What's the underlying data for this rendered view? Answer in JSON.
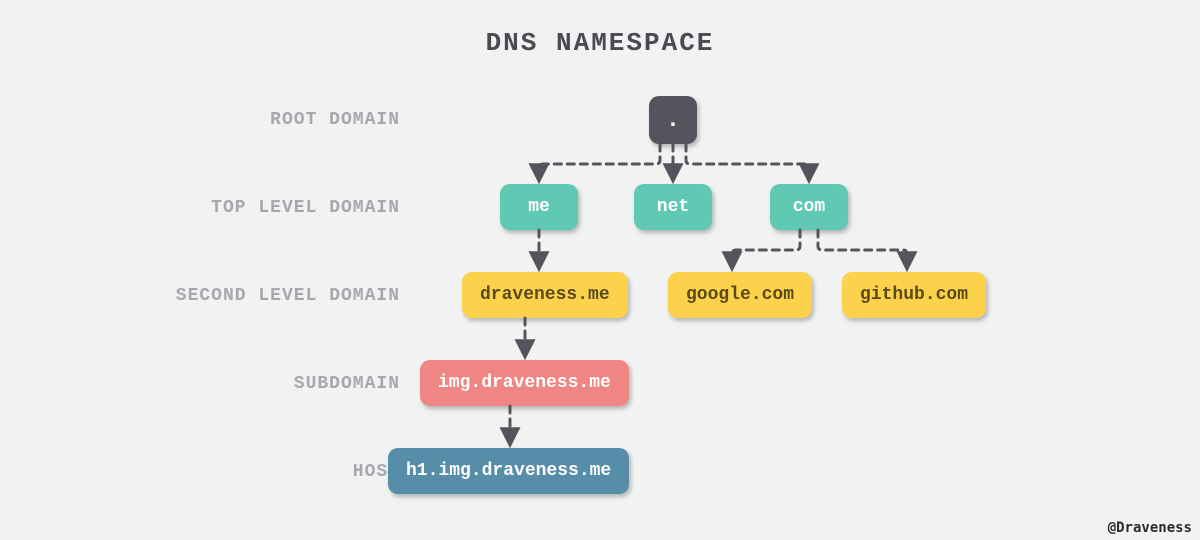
{
  "title": "DNS NAMESPACE",
  "levels": {
    "root": "ROOT DOMAIN",
    "tld": "TOP LEVEL DOMAIN",
    "sld": "SECOND LEVEL DOMAIN",
    "sub": "SUBDOMAIN",
    "host": "HOST"
  },
  "nodes": {
    "root": ".",
    "tld_me": "me",
    "tld_net": "net",
    "tld_com": "com",
    "sld_draveness": "draveness.me",
    "sld_google": "google.com",
    "sld_github": "github.com",
    "sub_img": "img.draveness.me",
    "host_h1": "h1.img.draveness.me"
  },
  "credit": "@Draveness",
  "diagram_data": {
    "type": "tree",
    "description": "DNS namespace hierarchy",
    "edges": [
      {
        "from": ".",
        "to": "me"
      },
      {
        "from": ".",
        "to": "net"
      },
      {
        "from": ".",
        "to": "com"
      },
      {
        "from": "me",
        "to": "draveness.me"
      },
      {
        "from": "com",
        "to": "google.com"
      },
      {
        "from": "com",
        "to": "github.com"
      },
      {
        "from": "draveness.me",
        "to": "img.draveness.me"
      },
      {
        "from": "img.draveness.me",
        "to": "h1.img.draveness.me"
      }
    ],
    "levels": [
      {
        "name": "ROOT DOMAIN",
        "nodes": [
          "."
        ]
      },
      {
        "name": "TOP LEVEL DOMAIN",
        "nodes": [
          "me",
          "net",
          "com"
        ]
      },
      {
        "name": "SECOND LEVEL DOMAIN",
        "nodes": [
          "draveness.me",
          "google.com",
          "github.com"
        ]
      },
      {
        "name": "SUBDOMAIN",
        "nodes": [
          "img.draveness.me"
        ]
      },
      {
        "name": "HOST",
        "nodes": [
          "h1.img.draveness.me"
        ]
      }
    ]
  }
}
